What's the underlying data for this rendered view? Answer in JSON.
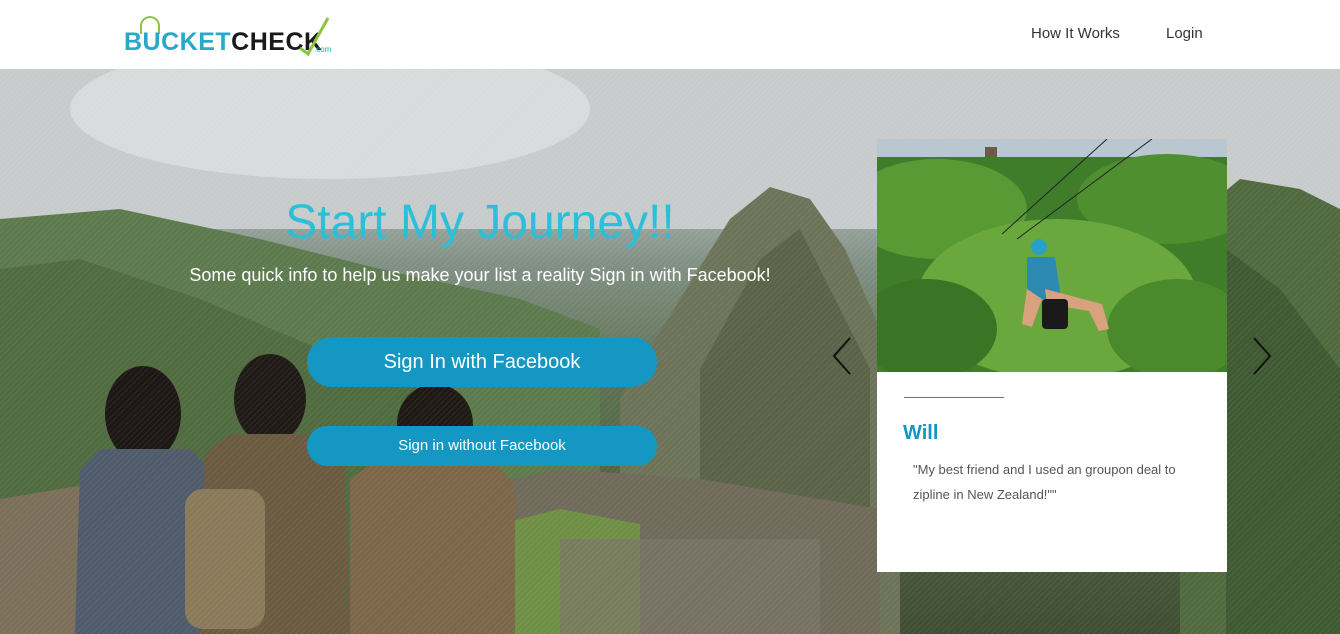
{
  "header": {
    "logo": {
      "bucket": "BUCKET",
      "check": "CHECK",
      "com": ".com"
    },
    "nav": [
      {
        "label": "How It Works"
      },
      {
        "label": "Login"
      }
    ]
  },
  "hero": {
    "title": "Start My Journey!!",
    "subtitle": "Some quick info to help us make your list a reality Sign in with Facebook!",
    "primary_button": "Sign In with Facebook",
    "secondary_button": "Sign in without Facebook",
    "prev_icon": "chevron-left-icon",
    "next_icon": "chevron-right-icon"
  },
  "testimonial": {
    "name": "Will",
    "quote": "\"My best friend and I used an groupon deal to zipline in New Zealand!\"\""
  },
  "colors": {
    "accent": "#1497c3",
    "title": "#2cc0d8",
    "logo_blue": "#29a9c9",
    "logo_green": "#8cc63f"
  }
}
